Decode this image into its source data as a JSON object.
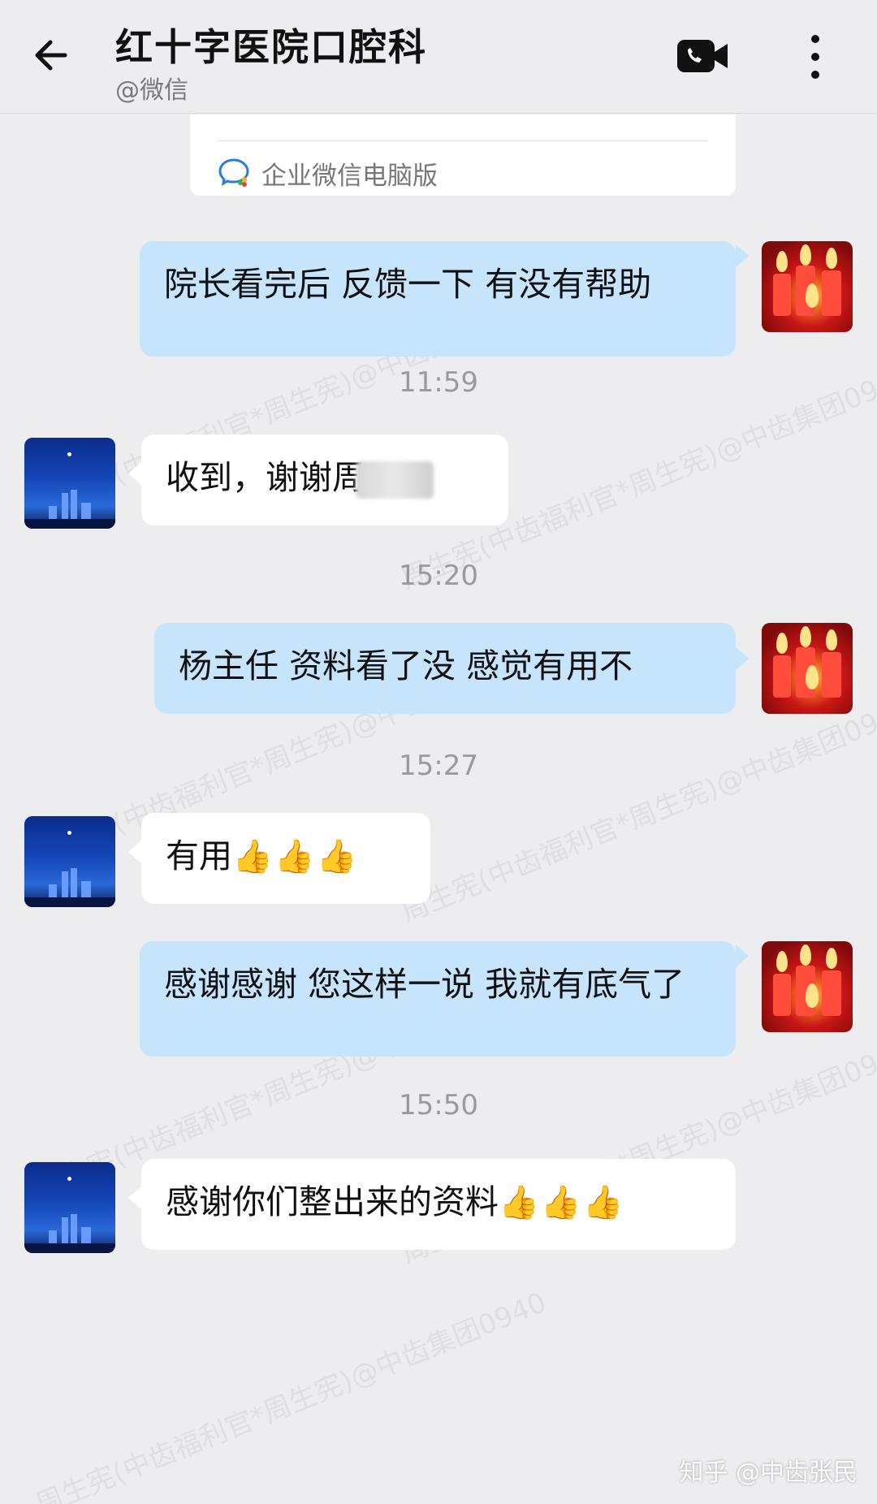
{
  "header": {
    "title": "红十字医院口腔科",
    "subtitle": "@微信"
  },
  "card": {
    "label": "企业微信电脑版"
  },
  "messages": [
    {
      "text": "院长看完后 反馈一下 有没有帮助"
    },
    {
      "time": "11:59"
    },
    {
      "text": "收到，谢谢周"
    },
    {
      "time": "15:20"
    },
    {
      "text": "杨主任 资料看了没 感觉有用不"
    },
    {
      "time": "15:27"
    },
    {
      "text": "有用",
      "emoji": "👍👍👍"
    },
    {
      "text": "感谢感谢 您这样一说  我就有底气了"
    },
    {
      "time": "15:50"
    },
    {
      "text": "感谢你们整出来的资料",
      "emoji": "👍👍👍"
    }
  ],
  "watermark": {
    "text_a": "周生宪(中齿福利官*周生宪)@中齿集团0940",
    "text_b": "周生宪(中齿福利官*周生宪)@中齿集团0940"
  },
  "footer": {
    "source": "知乎 @中齿张民"
  },
  "colors": {
    "bg": "#ededf0",
    "self_bubble": "#c6e4fb",
    "other_bubble": "#ffffff"
  }
}
